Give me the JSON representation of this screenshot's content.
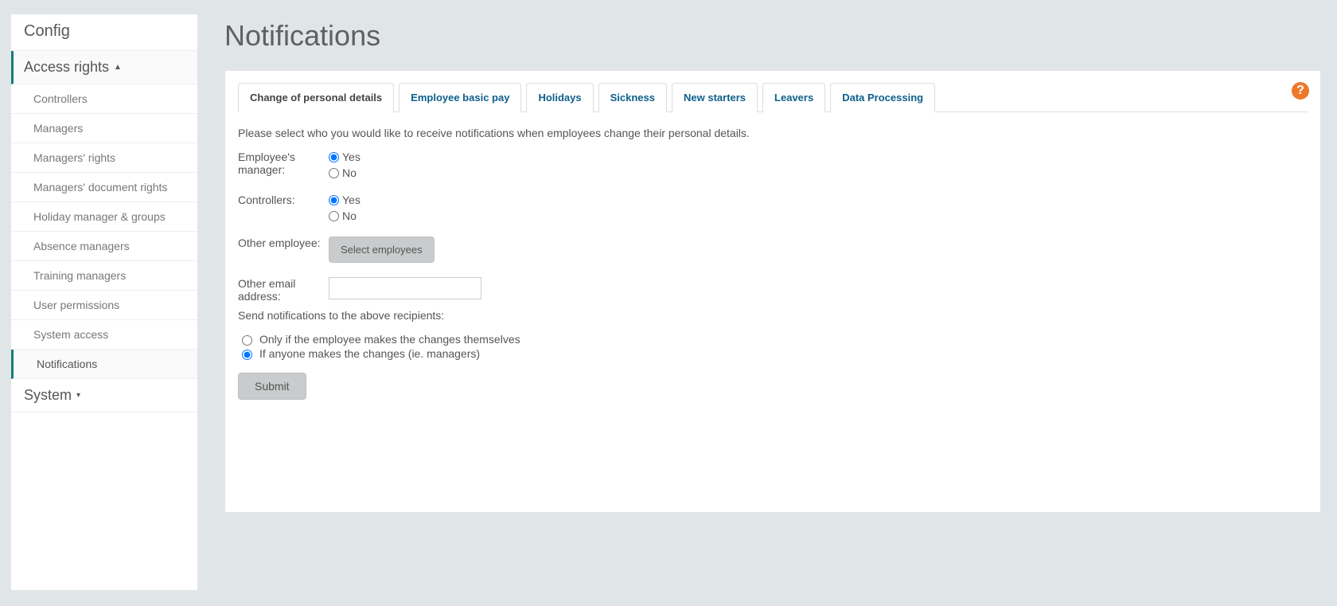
{
  "sidebar": {
    "header": "Config",
    "access_rights": {
      "title": "Access rights",
      "arrow": "▲",
      "items": [
        "Controllers",
        "Managers",
        "Managers' rights",
        "Managers' document rights",
        "Holiday manager & groups",
        "Absence managers",
        "Training managers",
        "User permissions",
        "System access",
        "Notifications"
      ]
    },
    "system": {
      "title": "System",
      "arrow": "▾"
    }
  },
  "page": {
    "title": "Notifications"
  },
  "tabs": [
    "Change of personal details",
    "Employee basic pay",
    "Holidays",
    "Sickness",
    "New starters",
    "Leavers",
    "Data Processing"
  ],
  "content": {
    "intro": "Please select who you would like to receive notifications when employees change their personal details.",
    "manager_label": "Employee's manager:",
    "controllers_label": "Controllers:",
    "other_emp_label": "Other employee:",
    "select_employees_btn": "Select employees",
    "other_email_label": "Other email address:",
    "send_to_label": "Send notifications to the above recipients:",
    "opt_self": "Only if the employee makes the changes themselves",
    "opt_anyone": "If anyone makes the changes (ie. managers)",
    "yes": "Yes",
    "no": "No",
    "submit": "Submit",
    "help": "?"
  }
}
